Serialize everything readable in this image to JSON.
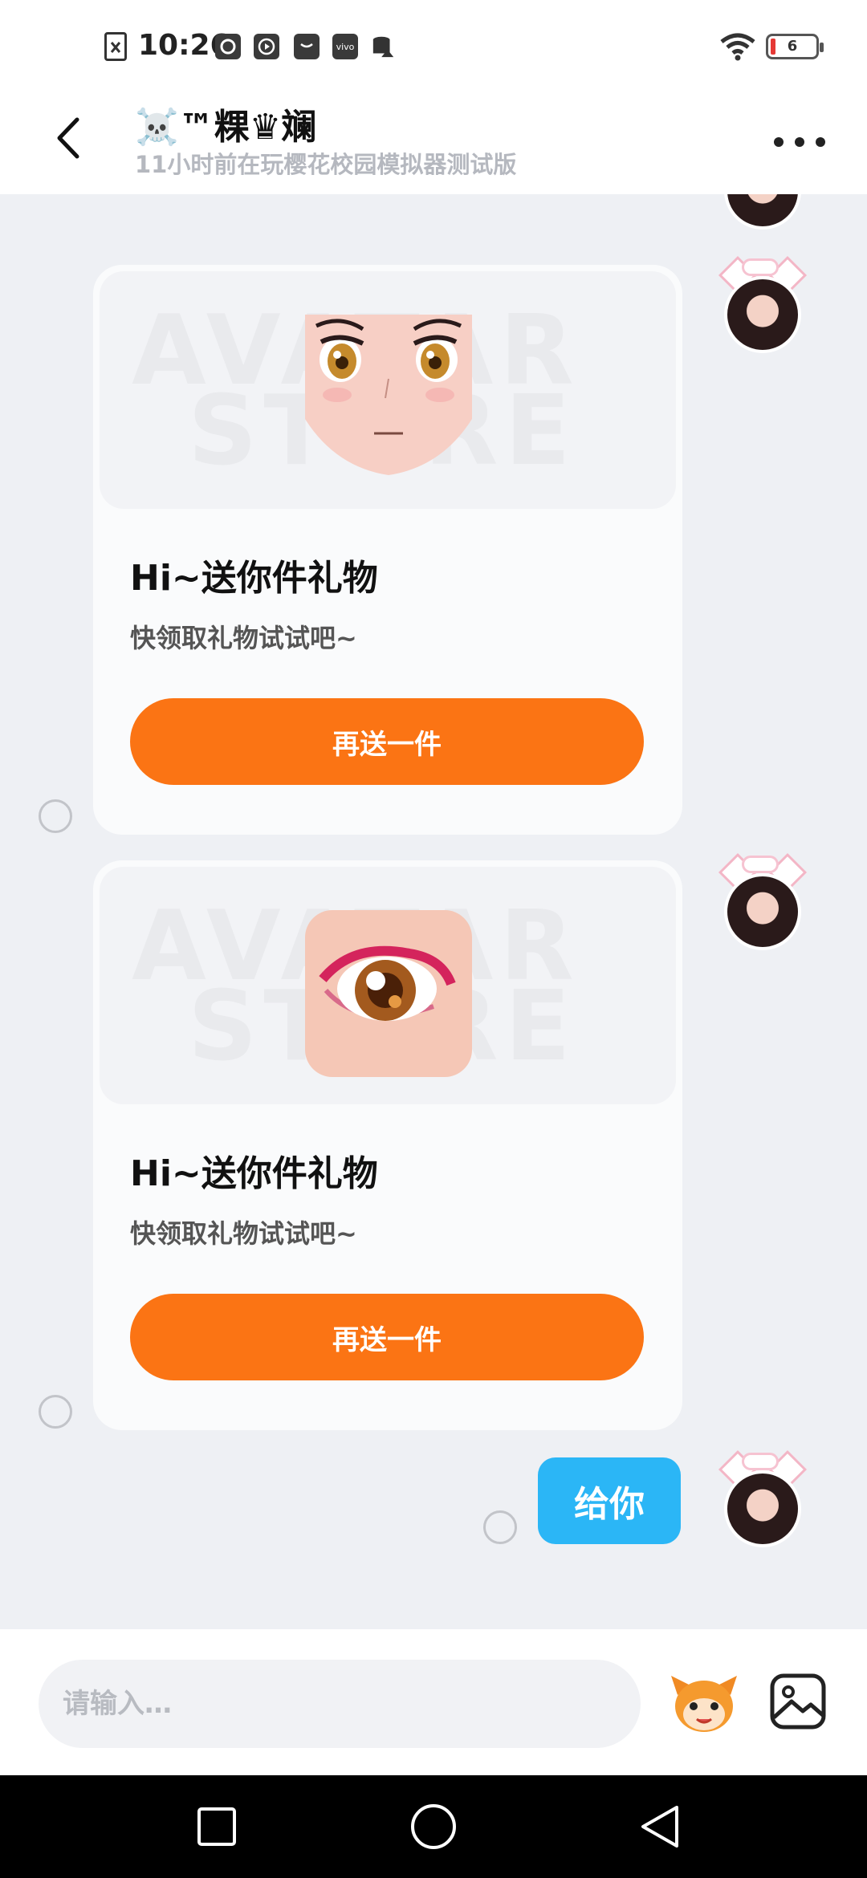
{
  "status_bar": {
    "time": "10:26",
    "notification_icons": [
      "file-x-icon",
      "qq-icon",
      "play-icon",
      "mail-icon",
      "vivo-icon",
      "storage-icon"
    ],
    "vivo_label": "vivo",
    "battery": "6",
    "battery_color": "#e53935"
  },
  "header": {
    "title": "☠️™粿♛斓",
    "subtitle": "11小时前在玩樱花校园模拟器测试版"
  },
  "messages": [
    {
      "type": "gift_card",
      "image": "anime-face-item",
      "watermark_1": "AVATAR",
      "watermark_2": "STORE",
      "title": "Hi~送你件礼物",
      "desc": "快领取礼物试试吧~",
      "button": "再送一件"
    },
    {
      "type": "gift_card",
      "image": "anime-eye-item",
      "watermark_1": "AVATAR",
      "watermark_2": "STORE",
      "title": "Hi~送你件礼物",
      "desc": "快领取礼物试试吧~",
      "button": "再送一件"
    },
    {
      "type": "text",
      "text": "给你"
    }
  ],
  "input": {
    "placeholder": "请输入…"
  },
  "colors": {
    "accent_orange": "#fb7414",
    "bubble_blue": "#2bb6f6"
  }
}
